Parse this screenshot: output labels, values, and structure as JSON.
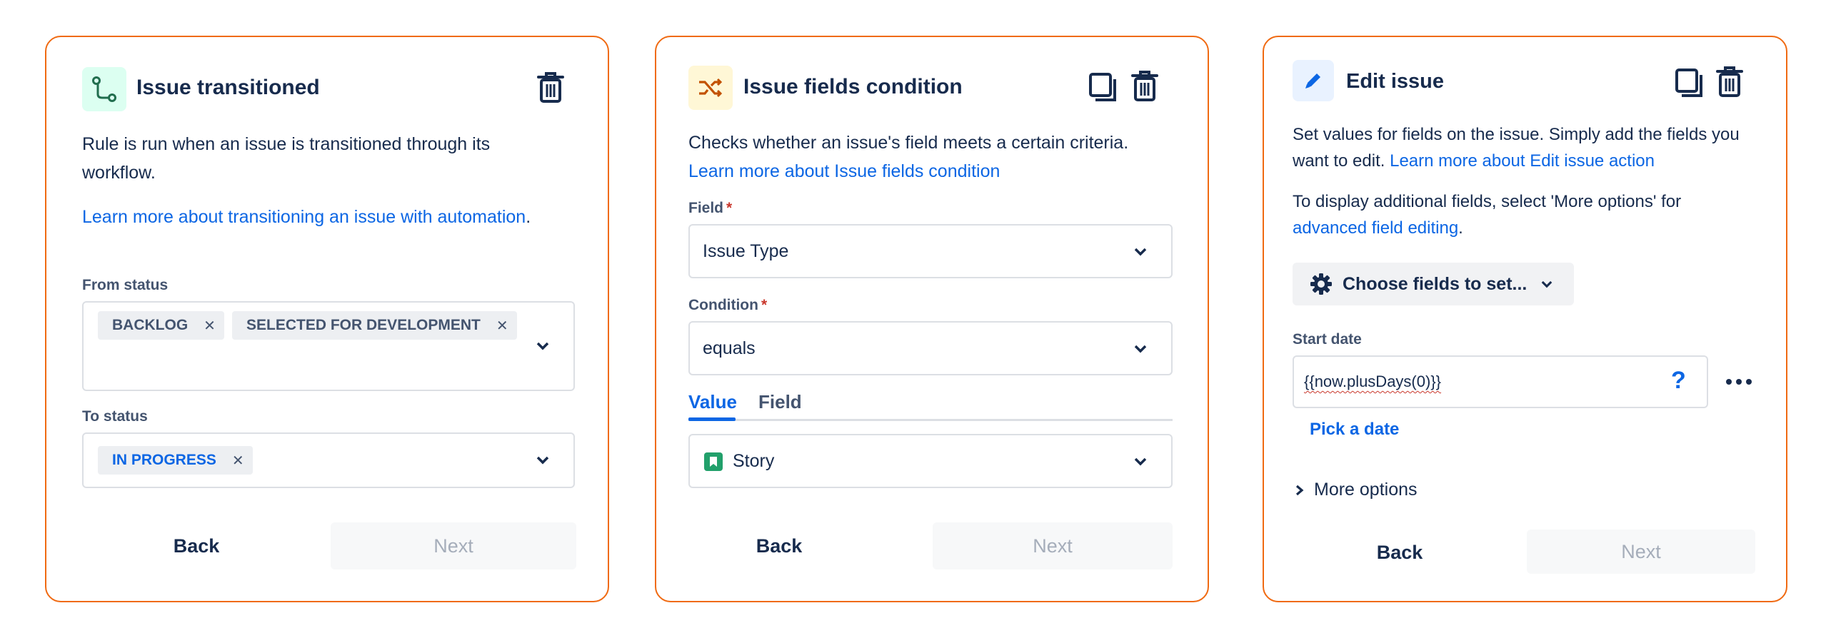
{
  "colors": {
    "panel_border": "#f06a12",
    "link": "#0c66e4",
    "text": "#172b4d",
    "required": "#c9372c",
    "story_green": "#22a06b"
  },
  "panel1": {
    "icon": "branch-transition-icon",
    "title": "Issue transitioned",
    "description": "Rule is run when an issue is transitioned through its workflow.",
    "learn_more_link": "Learn more about transitioning an issue with automation",
    "learn_more_suffix": ".",
    "from_status_label": "From status",
    "from_status_tags": [
      "BACKLOG",
      "SELECTED FOR DEVELOPMENT"
    ],
    "to_status_label": "To status",
    "to_status_tags": [
      "IN PROGRESS"
    ],
    "back_label": "Back",
    "next_label": "Next"
  },
  "panel2": {
    "icon": "shuffle-condition-icon",
    "title": "Issue fields condition",
    "description": "Checks whether an issue's field meets a certain criteria.",
    "learn_more_link": "Learn more about Issue fields condition",
    "field_label": "Field",
    "field_required_mark": "*",
    "field_value": "Issue Type",
    "condition_label": "Condition",
    "condition_required_mark": "*",
    "condition_value": "equals",
    "tabs": [
      "Value",
      "Field"
    ],
    "active_tab": "Value",
    "value_selected": "Story",
    "back_label": "Back",
    "next_label": "Next"
  },
  "panel3": {
    "icon": "pencil-icon",
    "title": "Edit issue",
    "description": "Set values for fields on the issue. Simply add the fields you want to edit.",
    "learn_more_link": "Learn more about Edit issue action",
    "additional_text": "To display additional fields, select 'More options' for",
    "advanced_link": "advanced field editing",
    "advanced_suffix": ".",
    "choose_fields_label": "Choose fields to set...",
    "start_date_label": "Start date",
    "start_date_value": "{{now.plusDays(0)}}",
    "help_mark": "?",
    "pick_date_label": "Pick a date",
    "more_options_label": "More options",
    "back_label": "Back",
    "next_label": "Next"
  }
}
